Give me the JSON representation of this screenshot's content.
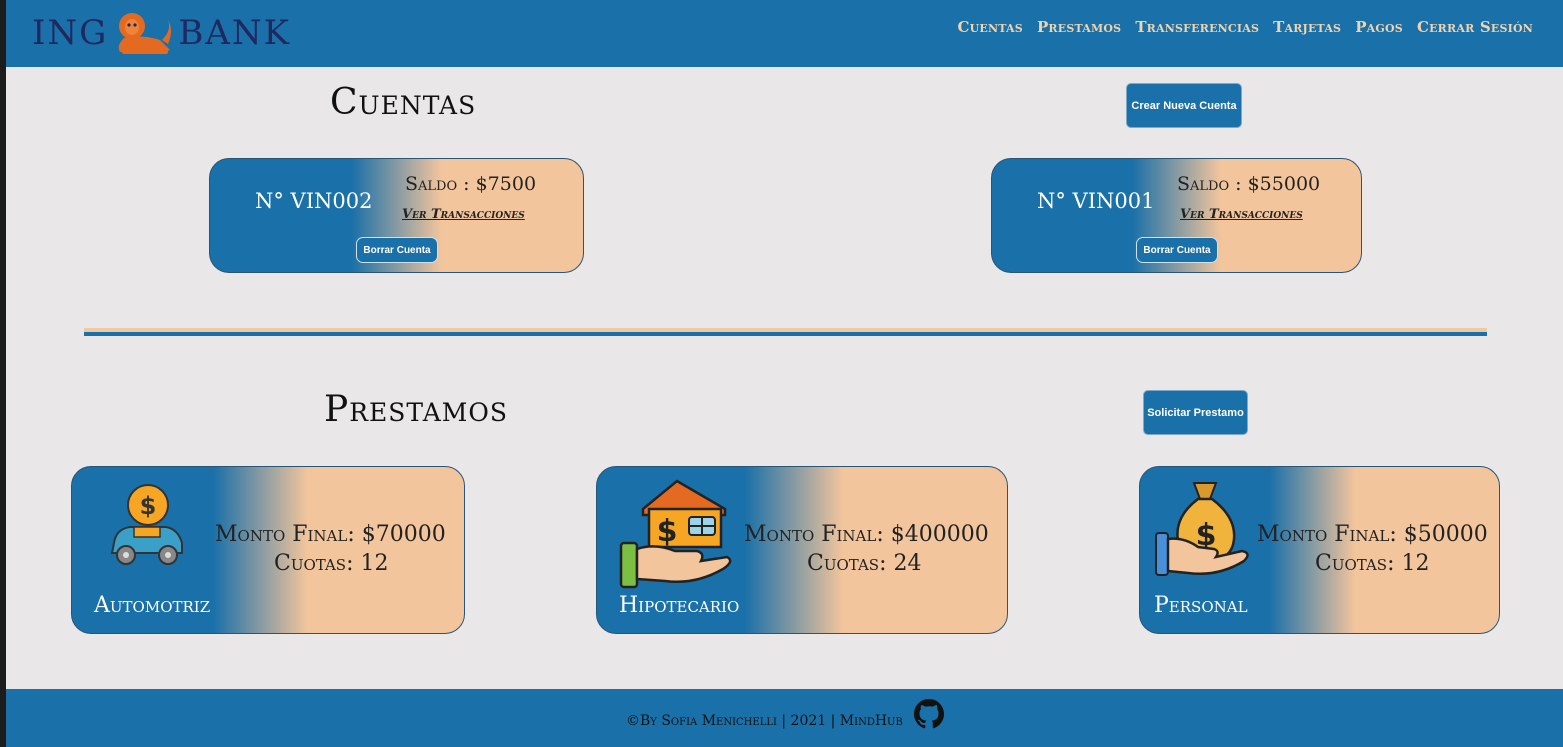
{
  "brand": {
    "left": "ING",
    "right": "BANK"
  },
  "nav": [
    "Cuentas",
    "Prestamos",
    "Transferencias",
    "Tarjetas",
    "Pagos",
    "Cerrar Sesión"
  ],
  "cuentas": {
    "title": "Cuentas",
    "create_button": "Crear Nueva Cuenta",
    "accounts": [
      {
        "number": "N° VIN002",
        "saldo": "Saldo : $7500",
        "link": "Ver Transacciones",
        "delete": "Borrar Cuenta"
      },
      {
        "number": "N° VIN001",
        "saldo": "Saldo : $55000",
        "link": "Ver Transacciones",
        "delete": "Borrar Cuenta"
      }
    ]
  },
  "prestamos": {
    "title": "Prestamos",
    "request_button": "Solicitar Prestamo",
    "loans": [
      {
        "monto": "Monto Final: $70000",
        "cuotas": "Cuotas: 12",
        "type": "Automotriz",
        "icon": "car-money-icon"
      },
      {
        "monto": "Monto Final: $400000",
        "cuotas": "Cuotas: 24",
        "type": "Hipotecario",
        "icon": "house-hand-icon"
      },
      {
        "monto": "Monto Final: $50000",
        "cuotas": "Cuotas: 12",
        "type": "Personal",
        "icon": "money-bag-hand-icon"
      }
    ]
  },
  "footer": {
    "text": "©By Sofia Menichelli | 2021 | MindHub",
    "icon": "github-icon"
  },
  "colors": {
    "primary": "#1a70a8",
    "accent": "#f2c59c",
    "background": "#e9e7e8",
    "logo": "#20295f"
  }
}
